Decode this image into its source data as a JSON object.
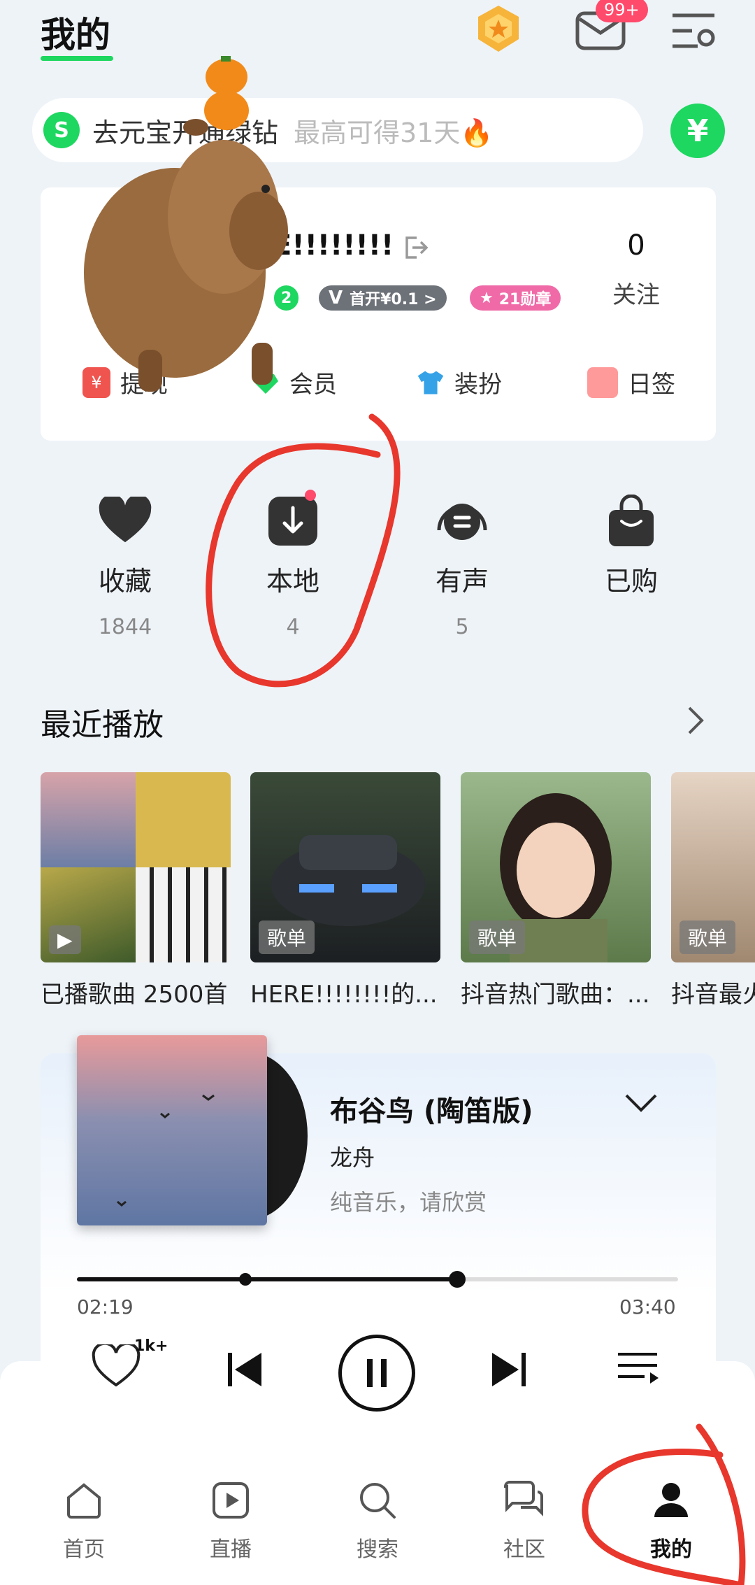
{
  "header": {
    "title": "我的",
    "mail_badge": "99+"
  },
  "vip_bar": {
    "text": "去元宝开通绿钻",
    "sub": "最高可得31天🔥"
  },
  "profile": {
    "username": "E!!!!!!!!",
    "follow_count": "0",
    "follow_label": "关注",
    "level_tag": "2",
    "vip_tag": "首开¥0.1 >",
    "medal_tag": "21勋章"
  },
  "quick_actions": [
    {
      "label": "提现",
      "icon": "withdraw-icon",
      "color": "#f0544f"
    },
    {
      "label": "会员",
      "icon": "vip-diamond-icon",
      "color": "#1ed760"
    },
    {
      "label": "装扮",
      "icon": "tshirt-icon",
      "color": "#35a2e8"
    },
    {
      "label": "日签",
      "icon": "daily-sign-icon",
      "color": "#ff9a9a"
    }
  ],
  "library": [
    {
      "label": "收藏",
      "count": "1844",
      "icon": "heart-icon"
    },
    {
      "label": "本地",
      "count": "4",
      "icon": "download-icon"
    },
    {
      "label": "有声",
      "count": "5",
      "icon": "audiobook-icon"
    },
    {
      "label": "已购",
      "count": "",
      "icon": "shopping-bag-icon"
    }
  ],
  "recent": {
    "title": "最近播放",
    "items": [
      {
        "caption": "已播歌曲 2500首",
        "tag": ""
      },
      {
        "caption": "HERE!!!!!!!!的...",
        "tag": "歌单"
      },
      {
        "caption": "抖音热门歌曲：...",
        "tag": "歌单"
      },
      {
        "caption": "抖音最火",
        "tag": "歌单"
      }
    ]
  },
  "player": {
    "song": "布谷鸟 (陶笛版)",
    "artist": "龙舟",
    "lyric": "纯音乐，请欣赏",
    "elapsed": "02:19",
    "duration": "03:40",
    "progress": 0.632,
    "like_count": "1k+"
  },
  "nav": [
    {
      "label": "首页",
      "icon": "home-icon"
    },
    {
      "label": "直播",
      "icon": "live-icon"
    },
    {
      "label": "搜索",
      "icon": "search-icon"
    },
    {
      "label": "社区",
      "icon": "community-icon"
    },
    {
      "label": "我的",
      "icon": "profile-icon",
      "active": true
    }
  ],
  "colors": {
    "accent": "#1ed760",
    "annotation": "#e8372c"
  }
}
